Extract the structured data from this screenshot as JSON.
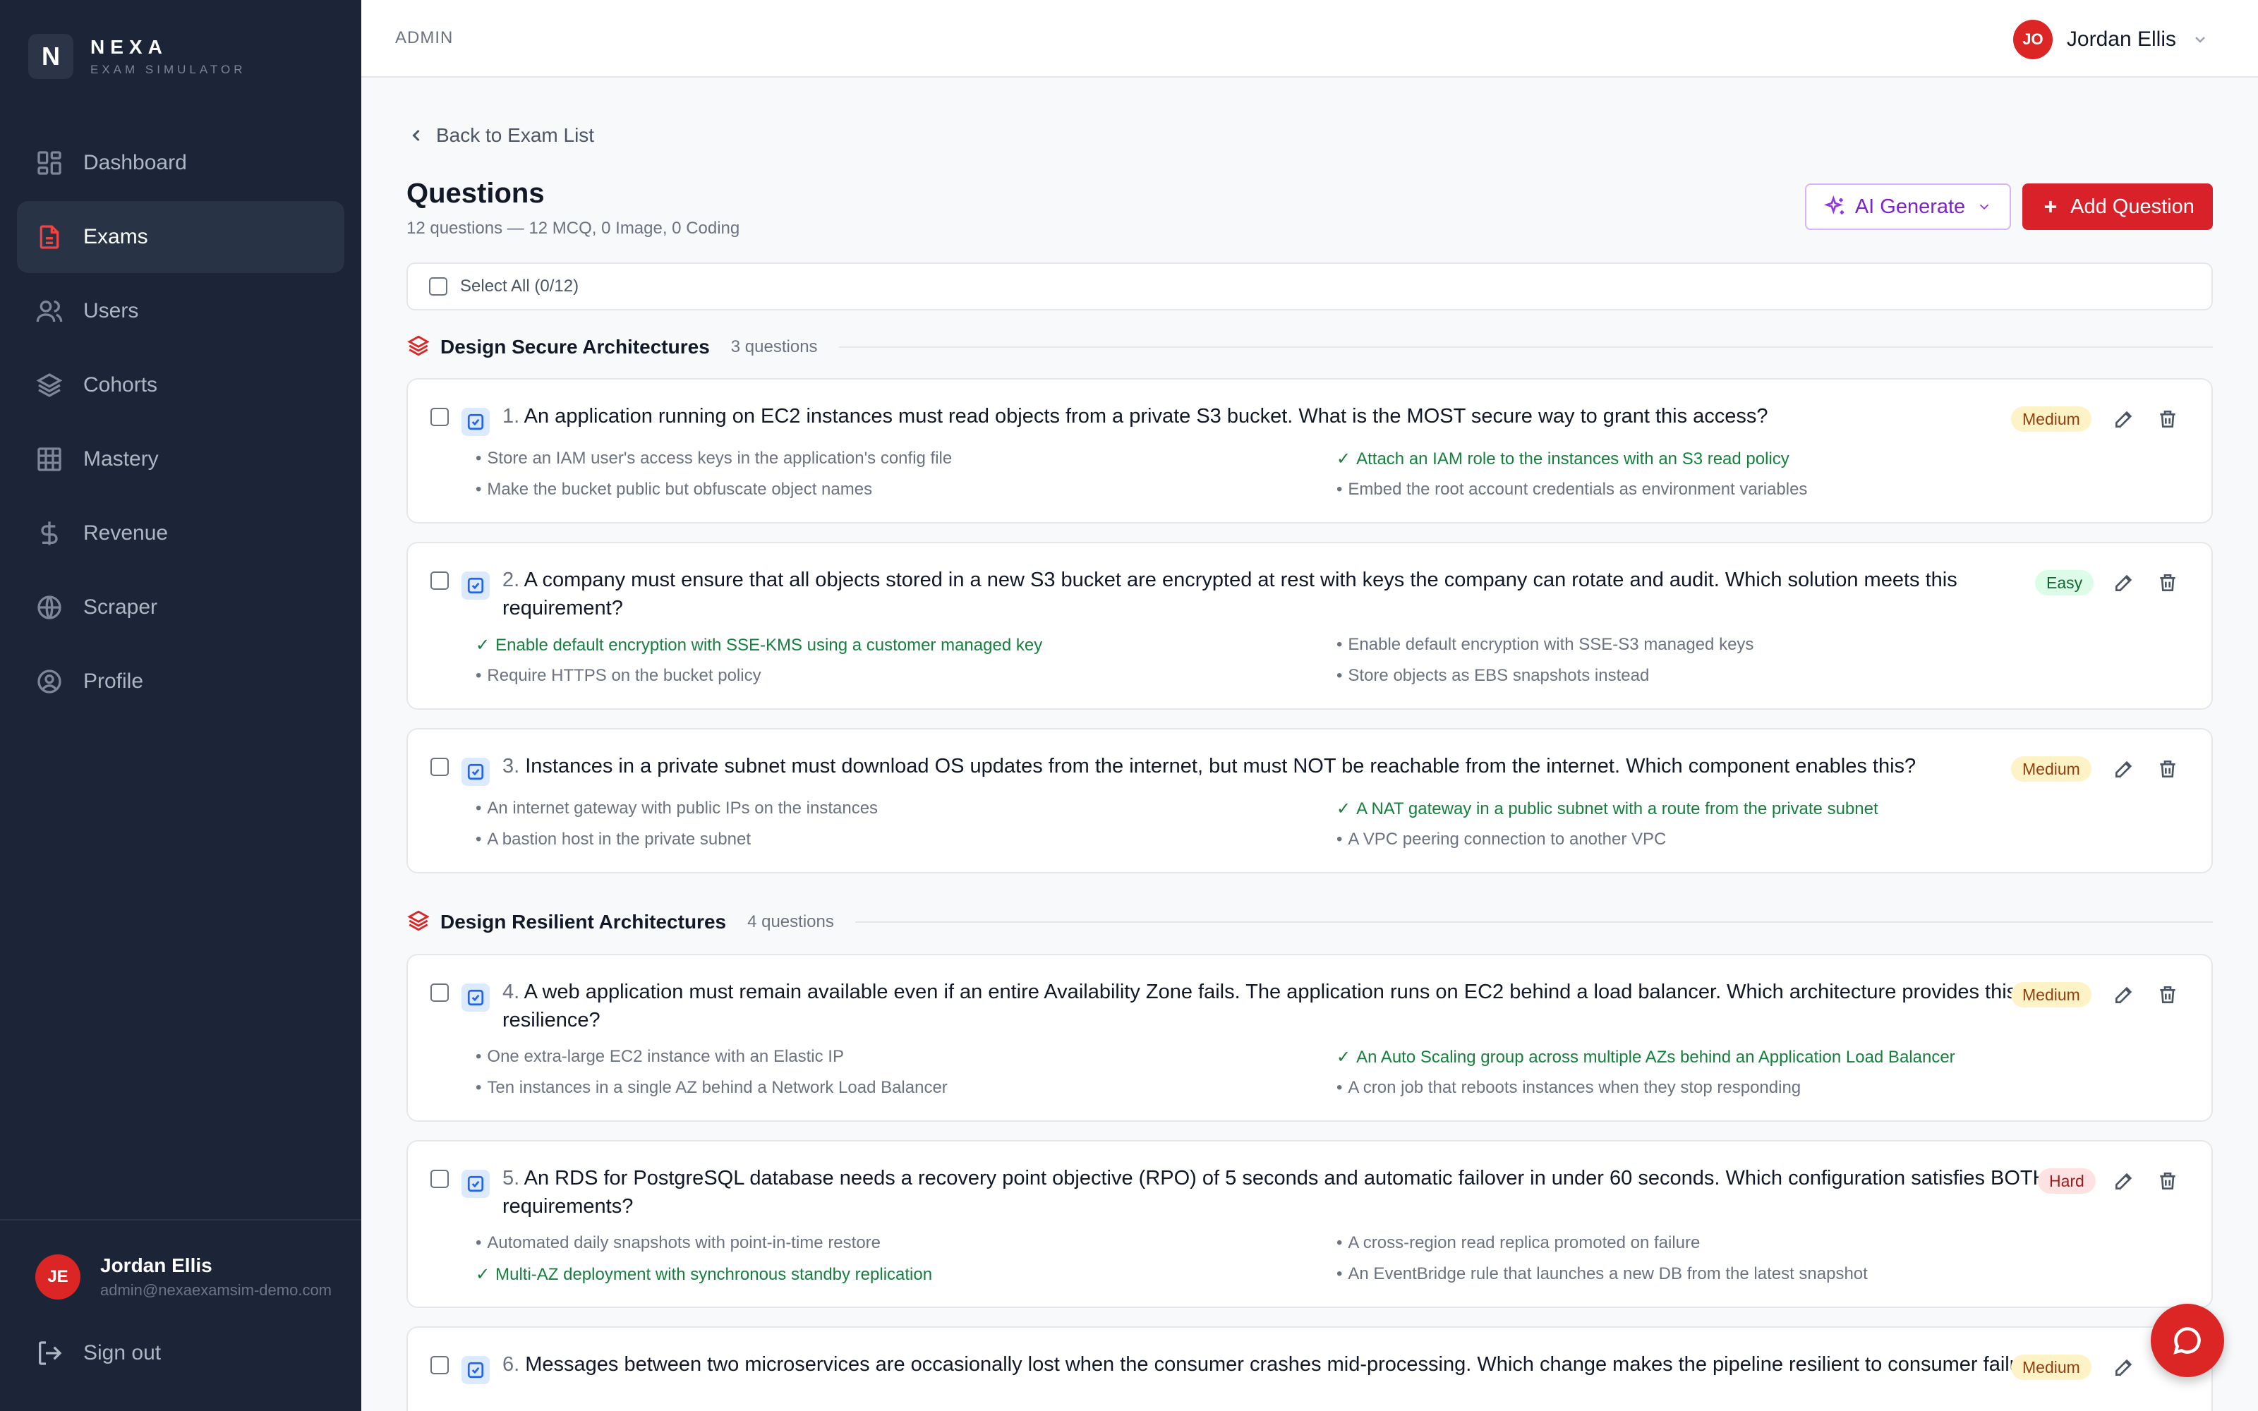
{
  "brand": {
    "logo_letter": "N",
    "name": "NEXA",
    "subtitle": "EXAM SIMULATOR"
  },
  "sidebar": {
    "items": [
      {
        "label": "Dashboard",
        "icon": "dashboard-icon",
        "active": false
      },
      {
        "label": "Exams",
        "icon": "document-icon",
        "active": true
      },
      {
        "label": "Users",
        "icon": "users-icon",
        "active": false
      },
      {
        "label": "Cohorts",
        "icon": "layers-icon",
        "active": false
      },
      {
        "label": "Mastery",
        "icon": "grid-icon",
        "active": false
      },
      {
        "label": "Revenue",
        "icon": "dollar-icon",
        "active": false
      },
      {
        "label": "Scraper",
        "icon": "globe-icon",
        "active": false
      },
      {
        "label": "Profile",
        "icon": "user-circle-icon",
        "active": false
      }
    ],
    "user": {
      "initials": "JE",
      "name": "Jordan Ellis",
      "email": "admin@nexaexamsim-demo.com"
    },
    "signout_label": "Sign out"
  },
  "topbar": {
    "breadcrumb": "ADMIN",
    "user_initials": "JO",
    "user_name": "Jordan Ellis"
  },
  "page": {
    "back_label": "Back to Exam List",
    "title": "Questions",
    "subtitle": "12 questions — 12 MCQ, 0 Image, 0 Coding",
    "ai_button": "AI Generate",
    "add_button": "Add Question",
    "select_all": "Select All (0/12)"
  },
  "sections": [
    {
      "title": "Design Secure Architectures",
      "count": "3 questions"
    },
    {
      "title": "Design Resilient Architectures",
      "count": "4 questions"
    }
  ],
  "questions": [
    {
      "num": "1.",
      "text": "An application running on EC2 instances must read objects from a private S3 bucket. What is the MOST secure way to grant this access?",
      "difficulty": "Medium",
      "options": [
        {
          "text": "Store an IAM user's access keys in the application's config file",
          "correct": false,
          "mark": "•"
        },
        {
          "text": "Attach an IAM role to the instances with an S3 read policy",
          "correct": true,
          "mark": "✓"
        },
        {
          "text": "Make the bucket public but obfuscate object names",
          "correct": false,
          "mark": "•"
        },
        {
          "text": "Embed the root account credentials as environment variables",
          "correct": false,
          "mark": "•"
        }
      ]
    },
    {
      "num": "2.",
      "text": "A company must ensure that all objects stored in a new S3 bucket are encrypted at rest with keys the company can rotate and audit. Which solution meets this requirement?",
      "difficulty": "Easy",
      "options": [
        {
          "text": "Enable default encryption with SSE-KMS using a customer managed key",
          "correct": true,
          "mark": "✓"
        },
        {
          "text": "Enable default encryption with SSE-S3 managed keys",
          "correct": false,
          "mark": "•"
        },
        {
          "text": "Require HTTPS on the bucket policy",
          "correct": false,
          "mark": "•"
        },
        {
          "text": "Store objects as EBS snapshots instead",
          "correct": false,
          "mark": "•"
        }
      ]
    },
    {
      "num": "3.",
      "text": "Instances in a private subnet must download OS updates from the internet, but must NOT be reachable from the internet. Which component enables this?",
      "difficulty": "Medium",
      "options": [
        {
          "text": "An internet gateway with public IPs on the instances",
          "correct": false,
          "mark": "•"
        },
        {
          "text": "A NAT gateway in a public subnet with a route from the private subnet",
          "correct": true,
          "mark": "✓"
        },
        {
          "text": "A bastion host in the private subnet",
          "correct": false,
          "mark": "•"
        },
        {
          "text": "A VPC peering connection to another VPC",
          "correct": false,
          "mark": "•"
        }
      ]
    },
    {
      "num": "4.",
      "text": "A web application must remain available even if an entire Availability Zone fails. The application runs on EC2 behind a load balancer. Which architecture provides this resilience?",
      "difficulty": "Medium",
      "options": [
        {
          "text": "One extra-large EC2 instance with an Elastic IP",
          "correct": false,
          "mark": "•"
        },
        {
          "text": "An Auto Scaling group across multiple AZs behind an Application Load Balancer",
          "correct": true,
          "mark": "✓"
        },
        {
          "text": "Ten instances in a single AZ behind a Network Load Balancer",
          "correct": false,
          "mark": "•"
        },
        {
          "text": "A cron job that reboots instances when they stop responding",
          "correct": false,
          "mark": "•"
        }
      ]
    },
    {
      "num": "5.",
      "text": "An RDS for PostgreSQL database needs a recovery point objective (RPO) of 5 seconds and automatic failover in under 60 seconds. Which configuration satisfies BOTH requirements?",
      "difficulty": "Hard",
      "options": [
        {
          "text": "Automated daily snapshots with point-in-time restore",
          "correct": false,
          "mark": "•"
        },
        {
          "text": "A cross-region read replica promoted on failure",
          "correct": false,
          "mark": "•"
        },
        {
          "text": "Multi-AZ deployment with synchronous standby replication",
          "correct": true,
          "mark": "✓"
        },
        {
          "text": "An EventBridge rule that launches a new DB from the latest snapshot",
          "correct": false,
          "mark": "•"
        }
      ]
    },
    {
      "num": "6.",
      "text": "Messages between two microservices are occasionally lost when the consumer crashes mid-processing. Which change makes the pipeline resilient to consumer failures?",
      "difficulty": "Medium",
      "options": []
    }
  ]
}
